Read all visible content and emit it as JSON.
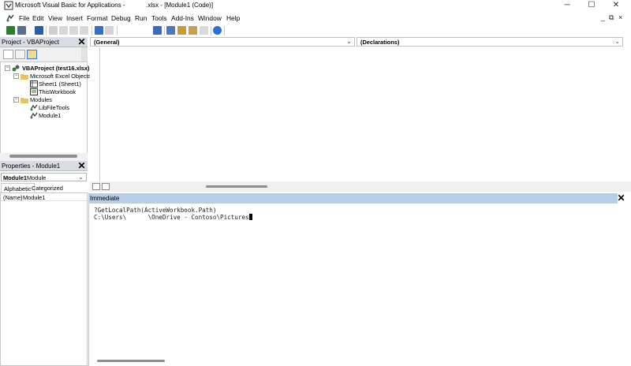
{
  "window": {
    "title_left": "Microsoft Visual Basic for Applications -",
    "title_right": ".xlsx - [Module1 (Code)]",
    "controls": [
      "─",
      "☐",
      "✕"
    ]
  },
  "menubar": {
    "items": [
      "File",
      "Edit",
      "View",
      "Insert",
      "Format",
      "Debug",
      "Run",
      "Tools",
      "Add-Ins",
      "Window",
      "Help"
    ],
    "mdi_controls": [
      "_",
      "⧉",
      "×"
    ]
  },
  "project": {
    "title": "Project - VBAProject",
    "close": "✕",
    "tree": [
      {
        "label": "VBAProject (test16.xlsx)",
        "level": 0,
        "expander": "−",
        "bold": true
      },
      {
        "label": "Microsoft Excel Objects",
        "level": 1,
        "expander": "−"
      },
      {
        "label": "Sheet1 (Sheet1)",
        "level": 2
      },
      {
        "label": "ThisWorkbook",
        "level": 2
      },
      {
        "label": "Modules",
        "level": 1,
        "expander": "−"
      },
      {
        "label": "LibFileTools",
        "level": 2
      },
      {
        "label": "Module1",
        "level": 2
      }
    ]
  },
  "properties": {
    "title": "Properties - Module1",
    "close": "✕",
    "object_name": "Module1",
    "object_type": "Module",
    "tabs": [
      "Alphabetic",
      "Categorized"
    ],
    "rows": [
      {
        "name": "(Name)",
        "value": "Module1"
      }
    ]
  },
  "code": {
    "object_dropdown": "(General)",
    "procedure_dropdown": "(Declarations)"
  },
  "immediate": {
    "title": "Immediate",
    "close": "✕",
    "lines": [
      "?GetLocalPath(ActiveWorkbook.Path)",
      "C:\\Users\\      \\OneDrive - Contoso\\Pictures"
    ]
  }
}
